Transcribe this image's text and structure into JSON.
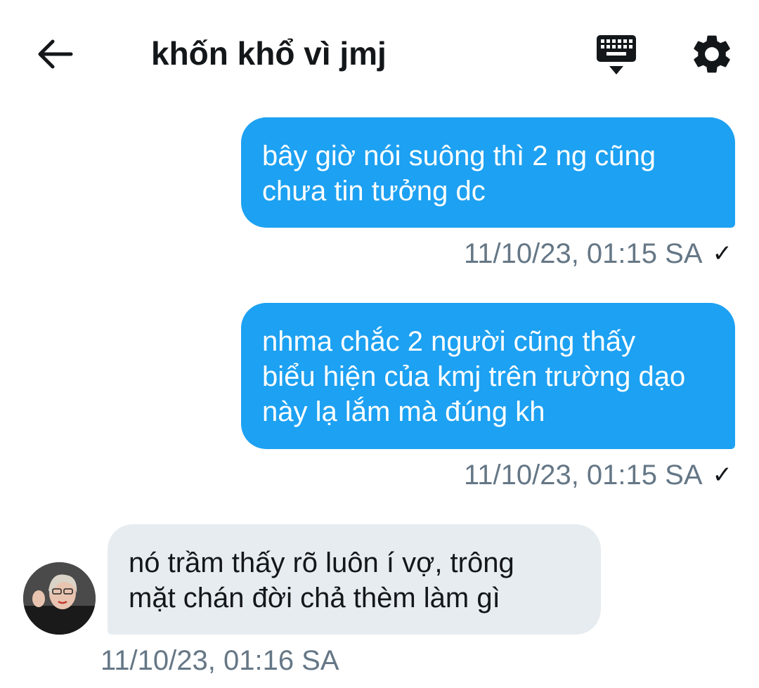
{
  "header": {
    "title": "khốn khổ vì jmj",
    "back_icon": "arrow-left-icon",
    "keyboard_icon": "keyboard-icon",
    "settings_icon": "gear-icon"
  },
  "messages": [
    {
      "direction": "outgoing",
      "text": "bây giờ nói suông thì 2 ng cũng\nchưa tin tưởng dc",
      "timestamp": "11/10/23, 01:15 SA",
      "status_icon": "✓"
    },
    {
      "direction": "outgoing",
      "text": "nhma chắc 2 người cũng thấy\nbiểu hiện của kmj trên trường dạo\nnày lạ lắm mà đúng kh",
      "timestamp": "11/10/23, 01:15 SA",
      "status_icon": "✓"
    },
    {
      "direction": "incoming",
      "text": "nó trầm thấy rõ luôn í vợ, trông\nmặt chán đời chả thèm làm gì",
      "timestamp": "11/10/23, 01:16 SA"
    }
  ],
  "colors": {
    "outgoing_bubble": "#1da1f2",
    "incoming_bubble": "#e6ecf0",
    "timestamp": "#657786",
    "text_dark": "#14171a"
  }
}
